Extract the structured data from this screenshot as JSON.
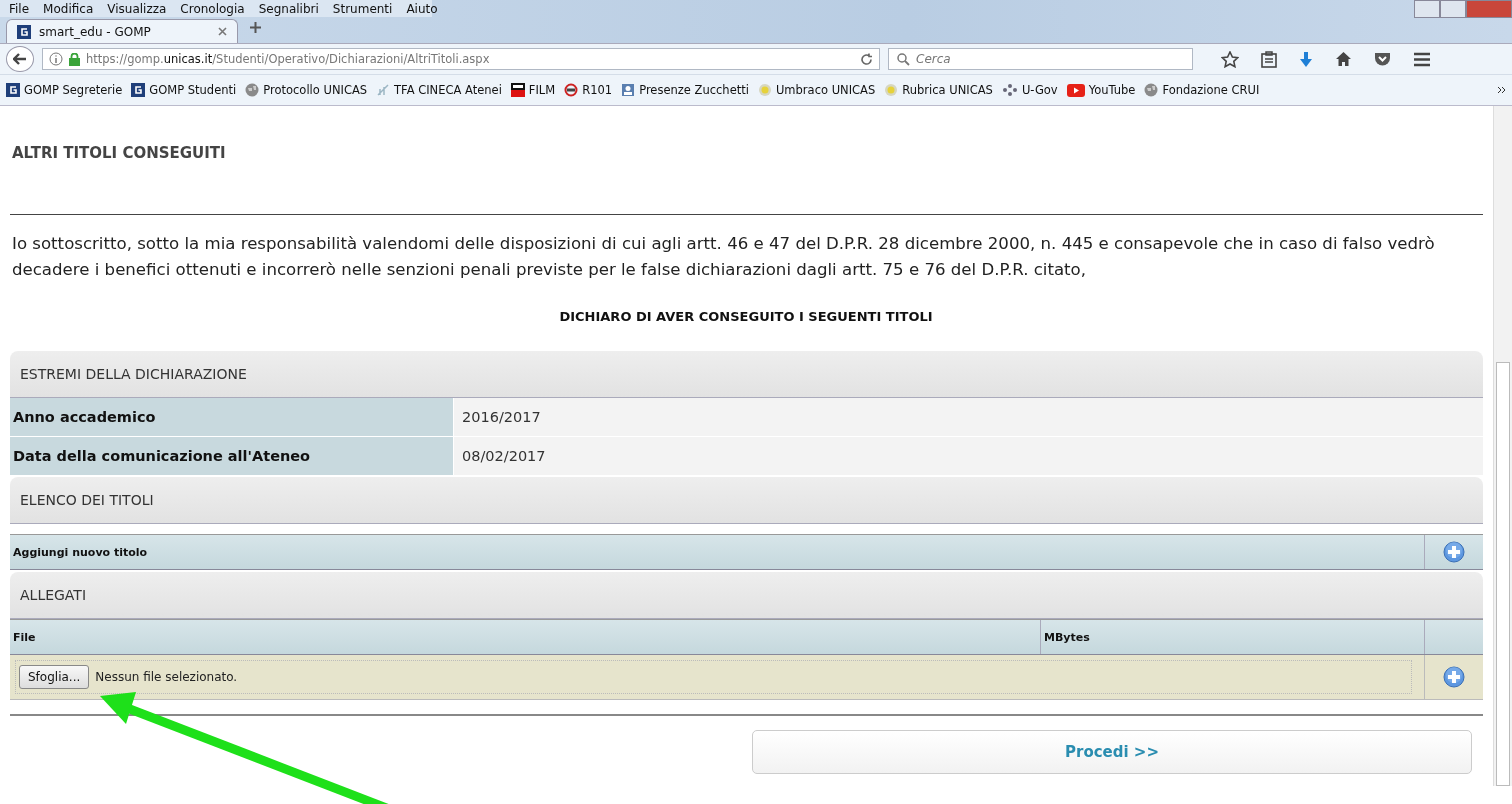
{
  "menu_bar": [
    "File",
    "Modifica",
    "Visualizza",
    "Cronologia",
    "Segnalibri",
    "Strumenti",
    "Aiuto"
  ],
  "tabs": [
    {
      "label": "smart_edu - GOMP",
      "selected": true
    }
  ],
  "address_bar": {
    "url": "https://gomp.**unicas.it**/Studenti/Operativo/Dichiarazioni/AltriTitoli.aspx"
  },
  "search": {
    "placeholder": "Cerca"
  },
  "bookmarks": [
    {
      "label": "GOMP Segreterie",
      "kind": "gomp"
    },
    {
      "label": "GOMP Studenti",
      "kind": "gomp"
    },
    {
      "label": "Protocollo UNICAS",
      "kind": "globe"
    },
    {
      "label": "TFA CINECA Atenei",
      "kind": "leaf"
    },
    {
      "label": "FILM",
      "kind": "film"
    },
    {
      "label": "R101",
      "kind": "radio"
    },
    {
      "label": "Presenze Zucchetti",
      "kind": "badge"
    },
    {
      "label": "Umbraco UNICAS",
      "kind": "sun"
    },
    {
      "label": "Rubrica UNICAS",
      "kind": "sun"
    },
    {
      "label": "U-Gov",
      "kind": "dots"
    },
    {
      "label": "YouTube",
      "kind": "youtube"
    },
    {
      "label": "Fondazione CRUI",
      "kind": "globe"
    }
  ],
  "page": {
    "title": "ALTRI TITOLI CONSEGUITI",
    "declaration": "Io sottoscritto, sotto la mia responsabilità valendomi delle disposizioni di cui agli artt. 46 e 47 del D.P.R. 28 dicembre 2000, n. 445 e consapevole che in caso di falso vedrò decadere i benefici ottenuti e incorrerò nelle senzioni penali previste per le false dichiarazioni dagli artt. 75 e 76 del D.P.R. citato,",
    "subtitle": "DICHIARO DI AVER CONSEGUITO I SEGUENTI TITOLI",
    "estremi": {
      "title": "ESTREMI DELLA DICHIARAZIONE",
      "rows": [
        {
          "label": "Anno accademico",
          "value": "2016/2017"
        },
        {
          "label": "Data della comunicazione all'Ateneo",
          "value": "08/02/2017"
        }
      ]
    },
    "elenco": {
      "title": "ELENCO DEI TITOLI",
      "add_label": "Aggiungi nuovo titolo"
    },
    "allegati": {
      "title": "ALLEGATI",
      "columns": [
        "File",
        "MBytes"
      ],
      "browse_button": "Sfoglia...",
      "file_status": "Nessun file selezionato."
    },
    "proceed_button": "Procedi >>"
  }
}
